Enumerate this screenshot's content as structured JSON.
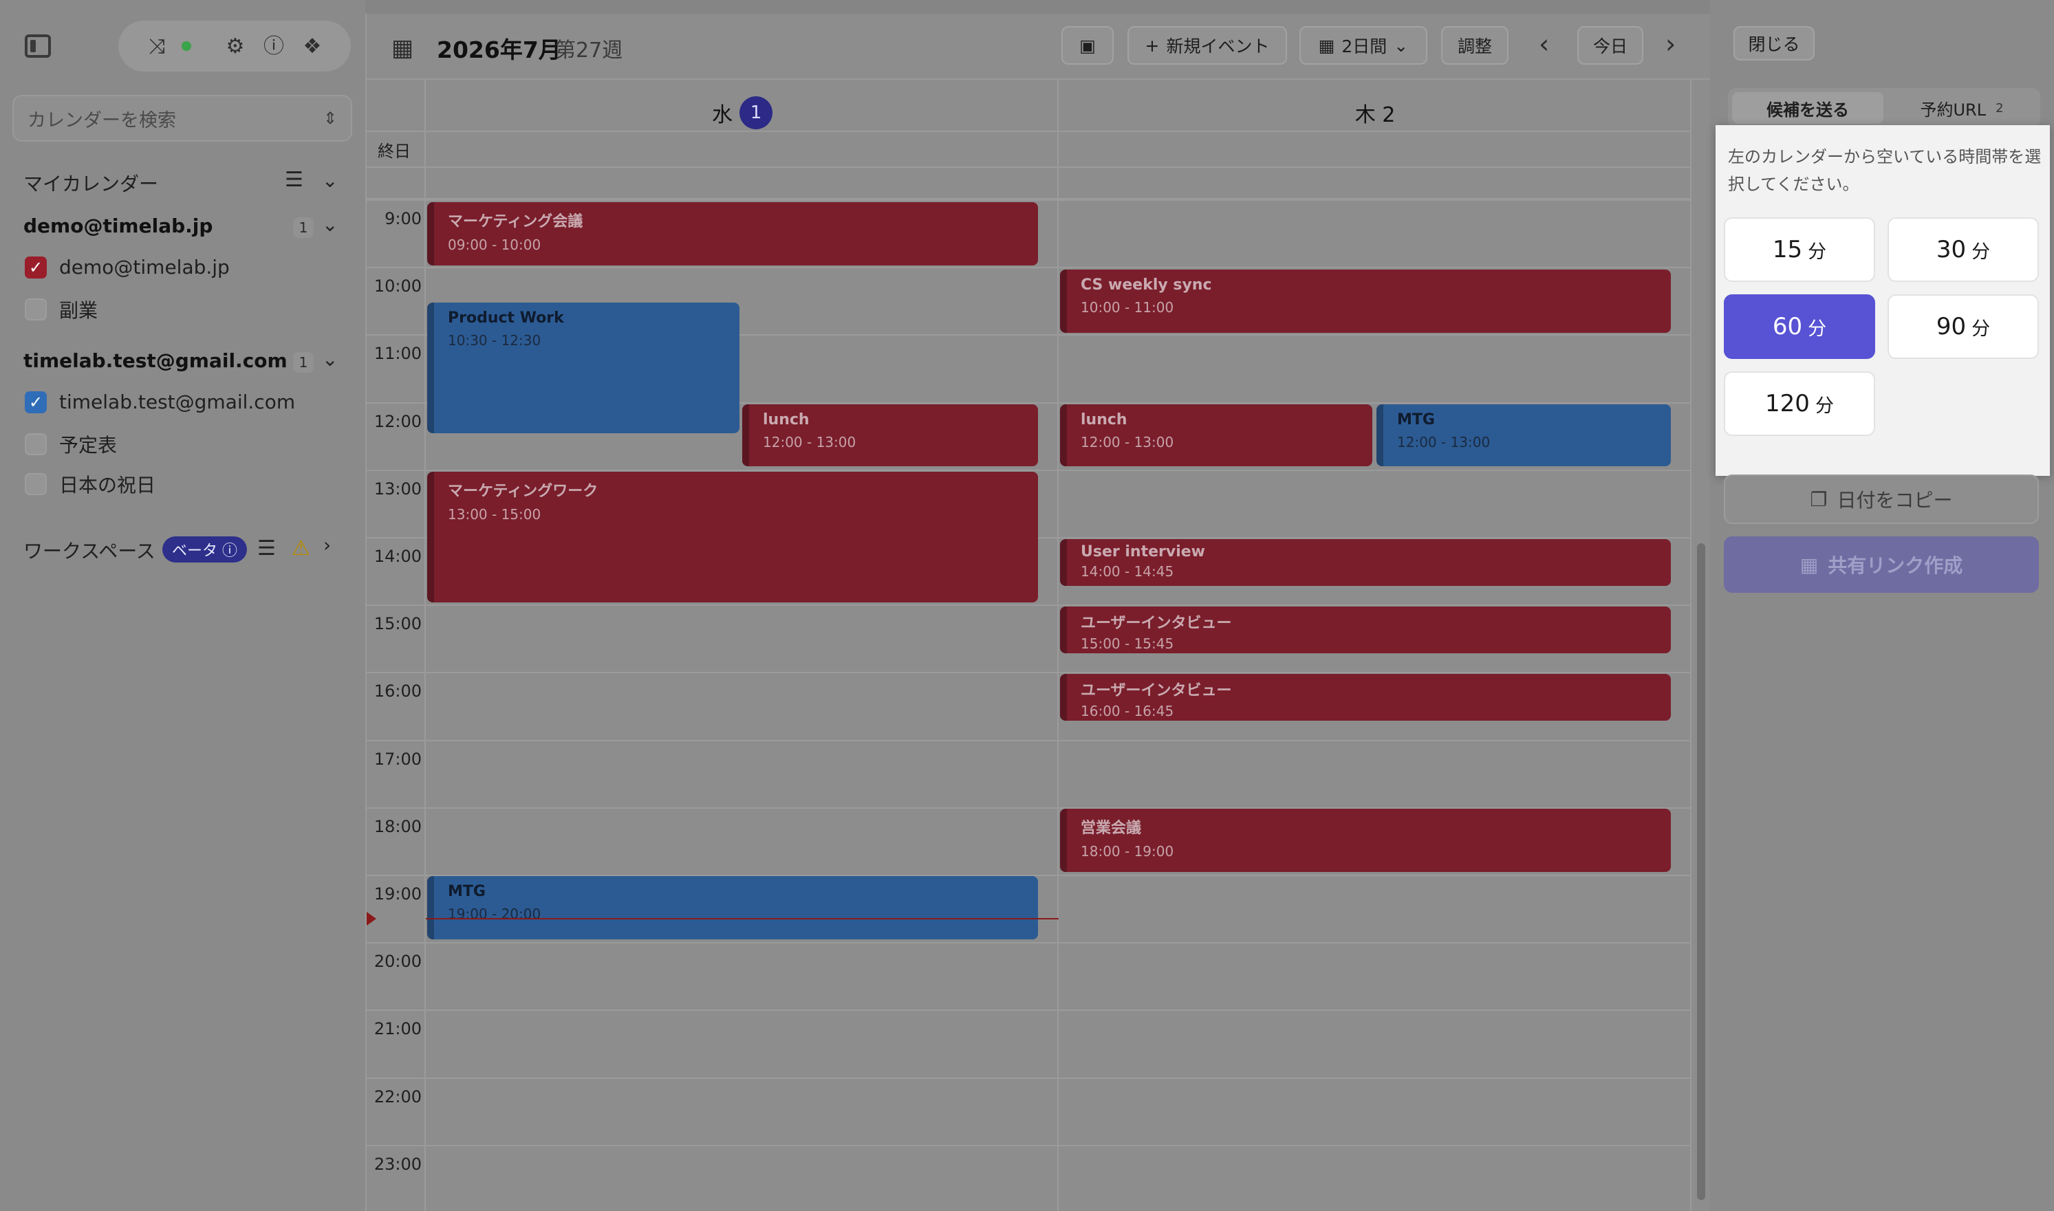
{
  "sidebar": {
    "search_placeholder": "カレンダーを検索",
    "my_calendars_label": "マイカレンダー",
    "accounts": [
      {
        "email": "demo@timelab.jp",
        "count": "1",
        "calendars": [
          {
            "label": "demo@timelab.jp",
            "checked": true,
            "color": "#9a1d2a"
          },
          {
            "label": "副業",
            "checked": false
          }
        ]
      },
      {
        "email": "timelab.test@gmail.com",
        "count": "1",
        "calendars": [
          {
            "label": "timelab.test@gmail.com",
            "checked": true,
            "color": "#2f6db8"
          },
          {
            "label": "予定表",
            "checked": false
          },
          {
            "label": "日本の祝日",
            "checked": false
          }
        ]
      }
    ],
    "workspace_label": "ワークスペース",
    "beta_label": "ベータ"
  },
  "toolbar": {
    "month_title": "2026年7月",
    "week_label": "第27週",
    "new_event_label": "新規イベント",
    "view_label": "2日間",
    "adjust_label": "調整",
    "today_label": "今日"
  },
  "days": [
    {
      "label": "水",
      "badge": "1"
    },
    {
      "label": "木 2"
    }
  ],
  "allday_label": "終日",
  "hours": [
    "9:00",
    "10:00",
    "11:00",
    "12:00",
    "13:00",
    "14:00",
    "15:00",
    "16:00",
    "17:00",
    "18:00",
    "19:00",
    "20:00",
    "21:00",
    "22:00",
    "23:00"
  ],
  "events": [
    {
      "title": "マーケティング会議",
      "time": "09:00 - 10:00"
    },
    {
      "title": "Product Work",
      "time": "10:30 - 12:30"
    },
    {
      "title": "lunch",
      "time": "12:00 - 13:00"
    },
    {
      "title": "マーケティングワーク",
      "time": "13:00 - 15:00"
    },
    {
      "title": "MTG",
      "time": "19:00 - 20:00"
    },
    {
      "title": "CS weekly sync",
      "time": "10:00 - 11:00"
    },
    {
      "title": "lunch",
      "time": "12:00 - 13:00"
    },
    {
      "title": "MTG",
      "time": "12:00 - 13:00"
    },
    {
      "title": "User interview",
      "time": "14:00 - 14:45"
    },
    {
      "title": "ユーザーインタビュー",
      "time": "15:00 - 15:45"
    },
    {
      "title": "ユーザーインタビュー",
      "time": "16:00 - 16:45"
    },
    {
      "title": "営業会議",
      "time": "18:00 - 19:00"
    }
  ],
  "right_panel": {
    "close_label": "閉じる",
    "tab_send": "候補を送る",
    "tab_booking": "予約URL",
    "tab_booking_count": "2",
    "instruction": "左のカレンダーから空いている時間帯を選択してください。",
    "durations": [
      {
        "value": "15",
        "unit": "分",
        "selected": false
      },
      {
        "value": "30",
        "unit": "分",
        "selected": false
      },
      {
        "value": "60",
        "unit": "分",
        "selected": true
      },
      {
        "value": "90",
        "unit": "分",
        "selected": false
      },
      {
        "value": "120",
        "unit": "分",
        "selected": false
      }
    ],
    "copy_dates_label": "日付をコピー",
    "share_link_label": "共有リンク作成"
  },
  "colors": {
    "event_red": "#7a1e2c",
    "event_blue": "#2c5b93",
    "accent": "#5753d4"
  }
}
